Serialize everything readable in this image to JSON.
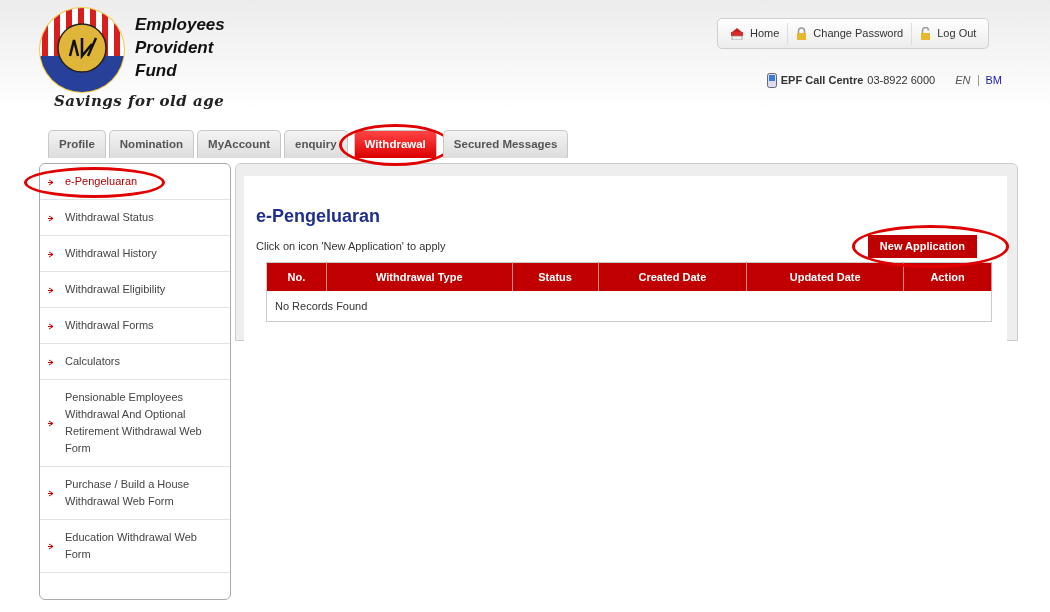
{
  "logo": {
    "lines": [
      "Employees",
      "Provident",
      "Fund"
    ],
    "tagline": "Savings for old age"
  },
  "top_links": [
    {
      "label": "Home",
      "kind": "home"
    },
    {
      "label": "Change Password",
      "kind": "lock"
    },
    {
      "label": "Log Out",
      "kind": "unlock"
    }
  ],
  "contact": {
    "label": "EPF Call Centre",
    "phone": "03-8922 6000"
  },
  "languages": [
    {
      "label": "EN",
      "selected": true
    },
    {
      "label": "BM",
      "selected": false
    }
  ],
  "tabs": [
    {
      "label": "Profile",
      "selected": false,
      "circled": false
    },
    {
      "label": "Nomination",
      "selected": false,
      "circled": false
    },
    {
      "label": "MyAccount",
      "selected": false,
      "circled": false
    },
    {
      "label": "enquiry",
      "selected": false,
      "circled": false
    },
    {
      "label": "Withdrawal",
      "selected": true,
      "circled": true
    },
    {
      "label": "Secured Messages",
      "selected": false,
      "circled": false
    }
  ],
  "sidebar": {
    "items": [
      {
        "label": "e-Pengeluaran",
        "selected": true,
        "circled": true
      },
      {
        "label": "Withdrawal Status",
        "selected": false,
        "circled": false
      },
      {
        "label": "Withdrawal History",
        "selected": false,
        "circled": false
      },
      {
        "label": "Withdrawal Eligibility",
        "selected": false,
        "circled": false
      },
      {
        "label": "Withdrawal Forms",
        "selected": false,
        "circled": false
      },
      {
        "label": "Calculators",
        "selected": false,
        "circled": false
      },
      {
        "label": "Pensionable Employees Withdrawal And Optional Retirement Withdrawal Web Form",
        "selected": false,
        "circled": false
      },
      {
        "label": "Purchase / Build a House Withdrawal Web Form",
        "selected": false,
        "circled": false
      },
      {
        "label": "Education Withdrawal Web Form",
        "selected": false,
        "circled": false
      }
    ]
  },
  "content": {
    "title": "e-Pengeluaran",
    "instruction": "Click on icon 'New Application' to apply",
    "new_button": {
      "label": "New Application",
      "circled": true
    },
    "table": {
      "columns": [
        "No.",
        "Withdrawal Type",
        "Status",
        "Created Date",
        "Updated Date",
        "Action"
      ],
      "empty_message": "No Records Found"
    }
  }
}
